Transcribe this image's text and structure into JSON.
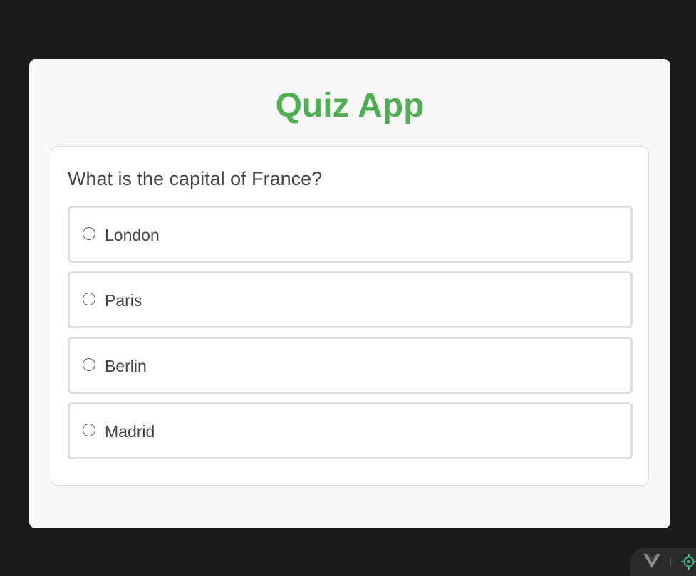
{
  "app": {
    "title": "Quiz App"
  },
  "quiz": {
    "question": "What is the capital of France?",
    "options": [
      {
        "label": "London",
        "selected": false
      },
      {
        "label": "Paris",
        "selected": false
      },
      {
        "label": "Berlin",
        "selected": false
      },
      {
        "label": "Madrid",
        "selected": false
      }
    ]
  },
  "devtools": {
    "icons": [
      "vue-logo-icon",
      "crosshair-target-icon"
    ]
  },
  "colors": {
    "page_background": "#1b1b1b",
    "card_background": "#f8f8f8",
    "title_accent": "#4caf50",
    "option_border": "#dddddd",
    "text": "#444444",
    "devtools_accent": "#42b883"
  }
}
